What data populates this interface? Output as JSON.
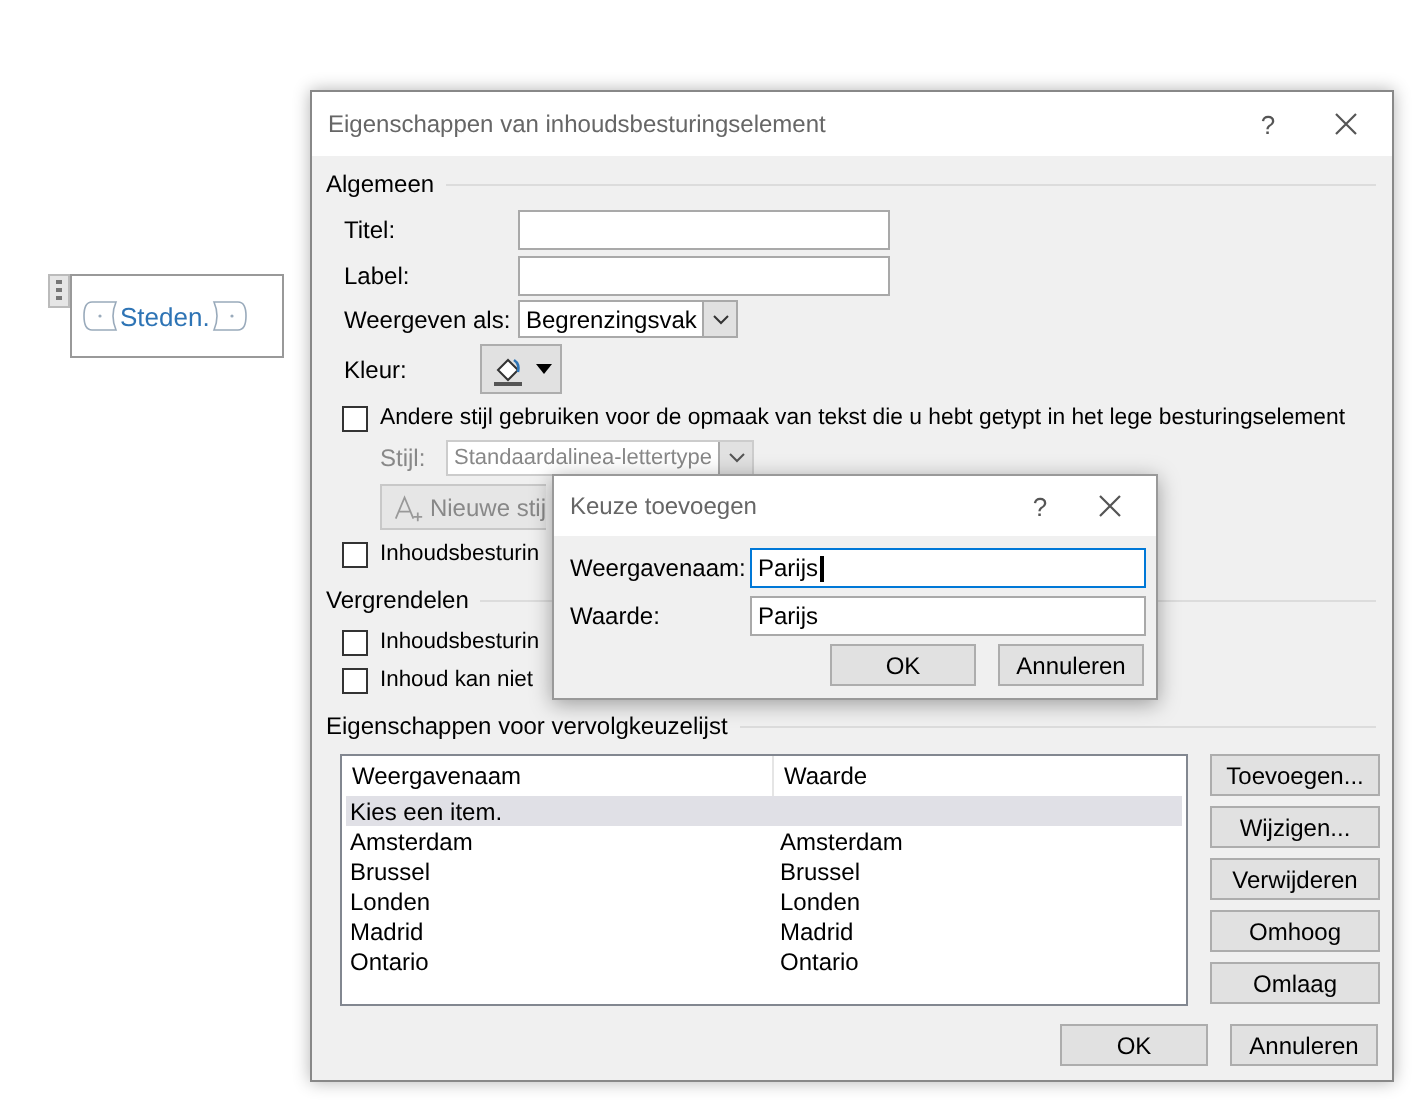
{
  "document": {
    "control_text": "Steden."
  },
  "dialog": {
    "title": "Eigenschappen van inhoudsbesturingselement",
    "help_button": "?",
    "general": {
      "heading": "Algemeen",
      "fields": [
        {
          "label": "Titel:"
        },
        {
          "label": "Label:"
        }
      ],
      "show_as": {
        "label": "Weergeven als:",
        "value": "Begrenzingsvak"
      },
      "color": {
        "label": "Kleur:"
      },
      "style_checkbox": {
        "label": "Andere stijl gebruiken voor de opmaak van tekst die u hebt getypt in het lege besturingselement",
        "checked": false
      },
      "style": {
        "label": "Stijl:",
        "value": "Standaardalinea-lettertype",
        "disabled": true
      },
      "new_style_button": {
        "label": "Nieuwe stij",
        "disabled": true
      },
      "remove_checkbox": {
        "label": "Inhoudsbesturin",
        "checked": false
      }
    },
    "locking": {
      "heading": "Vergrendelen",
      "checkboxes": [
        {
          "label": "Inhoudsbesturin",
          "checked": false
        },
        {
          "label": "Inhoud kan niet",
          "checked": false
        }
      ]
    },
    "dropdown": {
      "heading": "Eigenschappen voor vervolgkeuzelijst",
      "columns": [
        "Weergavenaam",
        "Waarde"
      ],
      "rows": [
        {
          "name": "Kies een item.",
          "selected": true
        },
        {
          "name": "Amsterdam",
          "value": "Amsterdam",
          "selected": false
        },
        {
          "name": "Brussel",
          "value": "Brussel",
          "selected": false
        },
        {
          "name": "Londen",
          "value": "Londen",
          "selected": false
        },
        {
          "name": "Madrid",
          "value": "Madrid",
          "selected": false
        },
        {
          "name": "Ontario",
          "value": "Ontario",
          "selected": false
        }
      ],
      "buttons": [
        "Toevoegen...",
        "Wijzigen...",
        "Verwijderen",
        "Omhoog",
        "Omlaag"
      ]
    },
    "buttons": [
      "OK",
      "Annuleren"
    ]
  },
  "choice_dialog": {
    "title": "Keuze toevoegen",
    "help_button": "?",
    "fields": [
      {
        "label": "Weergavenaam:",
        "value": "Parijs",
        "focused": true
      },
      {
        "label": "Waarde:",
        "value": "Parijs",
        "focused": false
      }
    ],
    "buttons": [
      "OK",
      "Annuleren"
    ]
  }
}
